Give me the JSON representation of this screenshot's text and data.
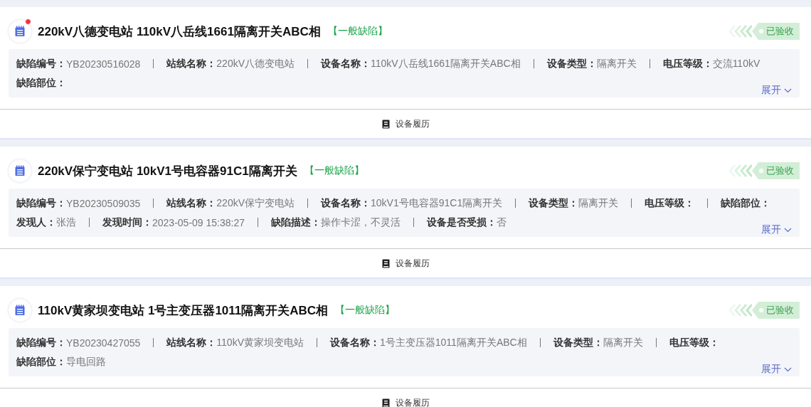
{
  "cards": [
    {
      "title": "220kV八德变电站 110kV八岳线1661隔离开关ABC相",
      "level": "【一般缺陷】",
      "unread": true,
      "status": "已验收",
      "lines": [
        [
          {
            "label": "缺陷编号：",
            "value": "YB20230516028"
          },
          {
            "label": "站线名称：",
            "value": "220kV八德变电站"
          },
          {
            "label": "设备名称：",
            "value": "110kV八岳线1661隔离开关ABC相"
          },
          {
            "label": "设备类型：",
            "value": "隔离开关"
          },
          {
            "label": "电压等级：",
            "value": "交流110kV"
          }
        ],
        [
          {
            "label": "缺陷部位："
          }
        ]
      ],
      "expand": "展开",
      "history": "设备履历"
    },
    {
      "title": "220kV保宁变电站 10kV1号电容器91C1隔离开关",
      "level": "【一般缺陷】",
      "unread": false,
      "status": "已验收",
      "lines": [
        [
          {
            "label": "缺陷编号：",
            "value": "YB20230509035"
          },
          {
            "label": "站线名称：",
            "value": "220kV保宁变电站"
          },
          {
            "label": "设备名称：",
            "value": "10kV1号电容器91C1隔离开关"
          },
          {
            "label": "设备类型：",
            "value": "隔离开关"
          },
          {
            "label": "电压等级："
          },
          {
            "label": "缺陷部位："
          }
        ],
        [
          {
            "label": "发现人：",
            "value": "张浩"
          },
          {
            "label": "发现时间：",
            "value": "2023-05-09 15:38:27"
          },
          {
            "label": "缺陷描述：",
            "value": "操作卡涩，不灵活"
          },
          {
            "label": "设备是否受损：",
            "value": "否"
          }
        ]
      ],
      "expand": "展开",
      "history": "设备履历"
    },
    {
      "title": "110kV黄家坝变电站 1号主变压器1011隔离开关ABC相",
      "level": "【一般缺陷】",
      "unread": false,
      "status": "已验收",
      "lines": [
        [
          {
            "label": "缺陷编号：",
            "value": "YB20230427055"
          },
          {
            "label": "站线名称：",
            "value": "110kV黄家坝变电站"
          },
          {
            "label": "设备名称：",
            "value": "1号主变压器1011隔离开关ABC相"
          },
          {
            "label": "设备类型：",
            "value": "隔离开关"
          },
          {
            "label": "电压等级："
          }
        ],
        [
          {
            "label": "缺陷部位：",
            "value": "导电回路"
          }
        ]
      ],
      "expand": "展开",
      "history": "设备履历"
    }
  ]
}
